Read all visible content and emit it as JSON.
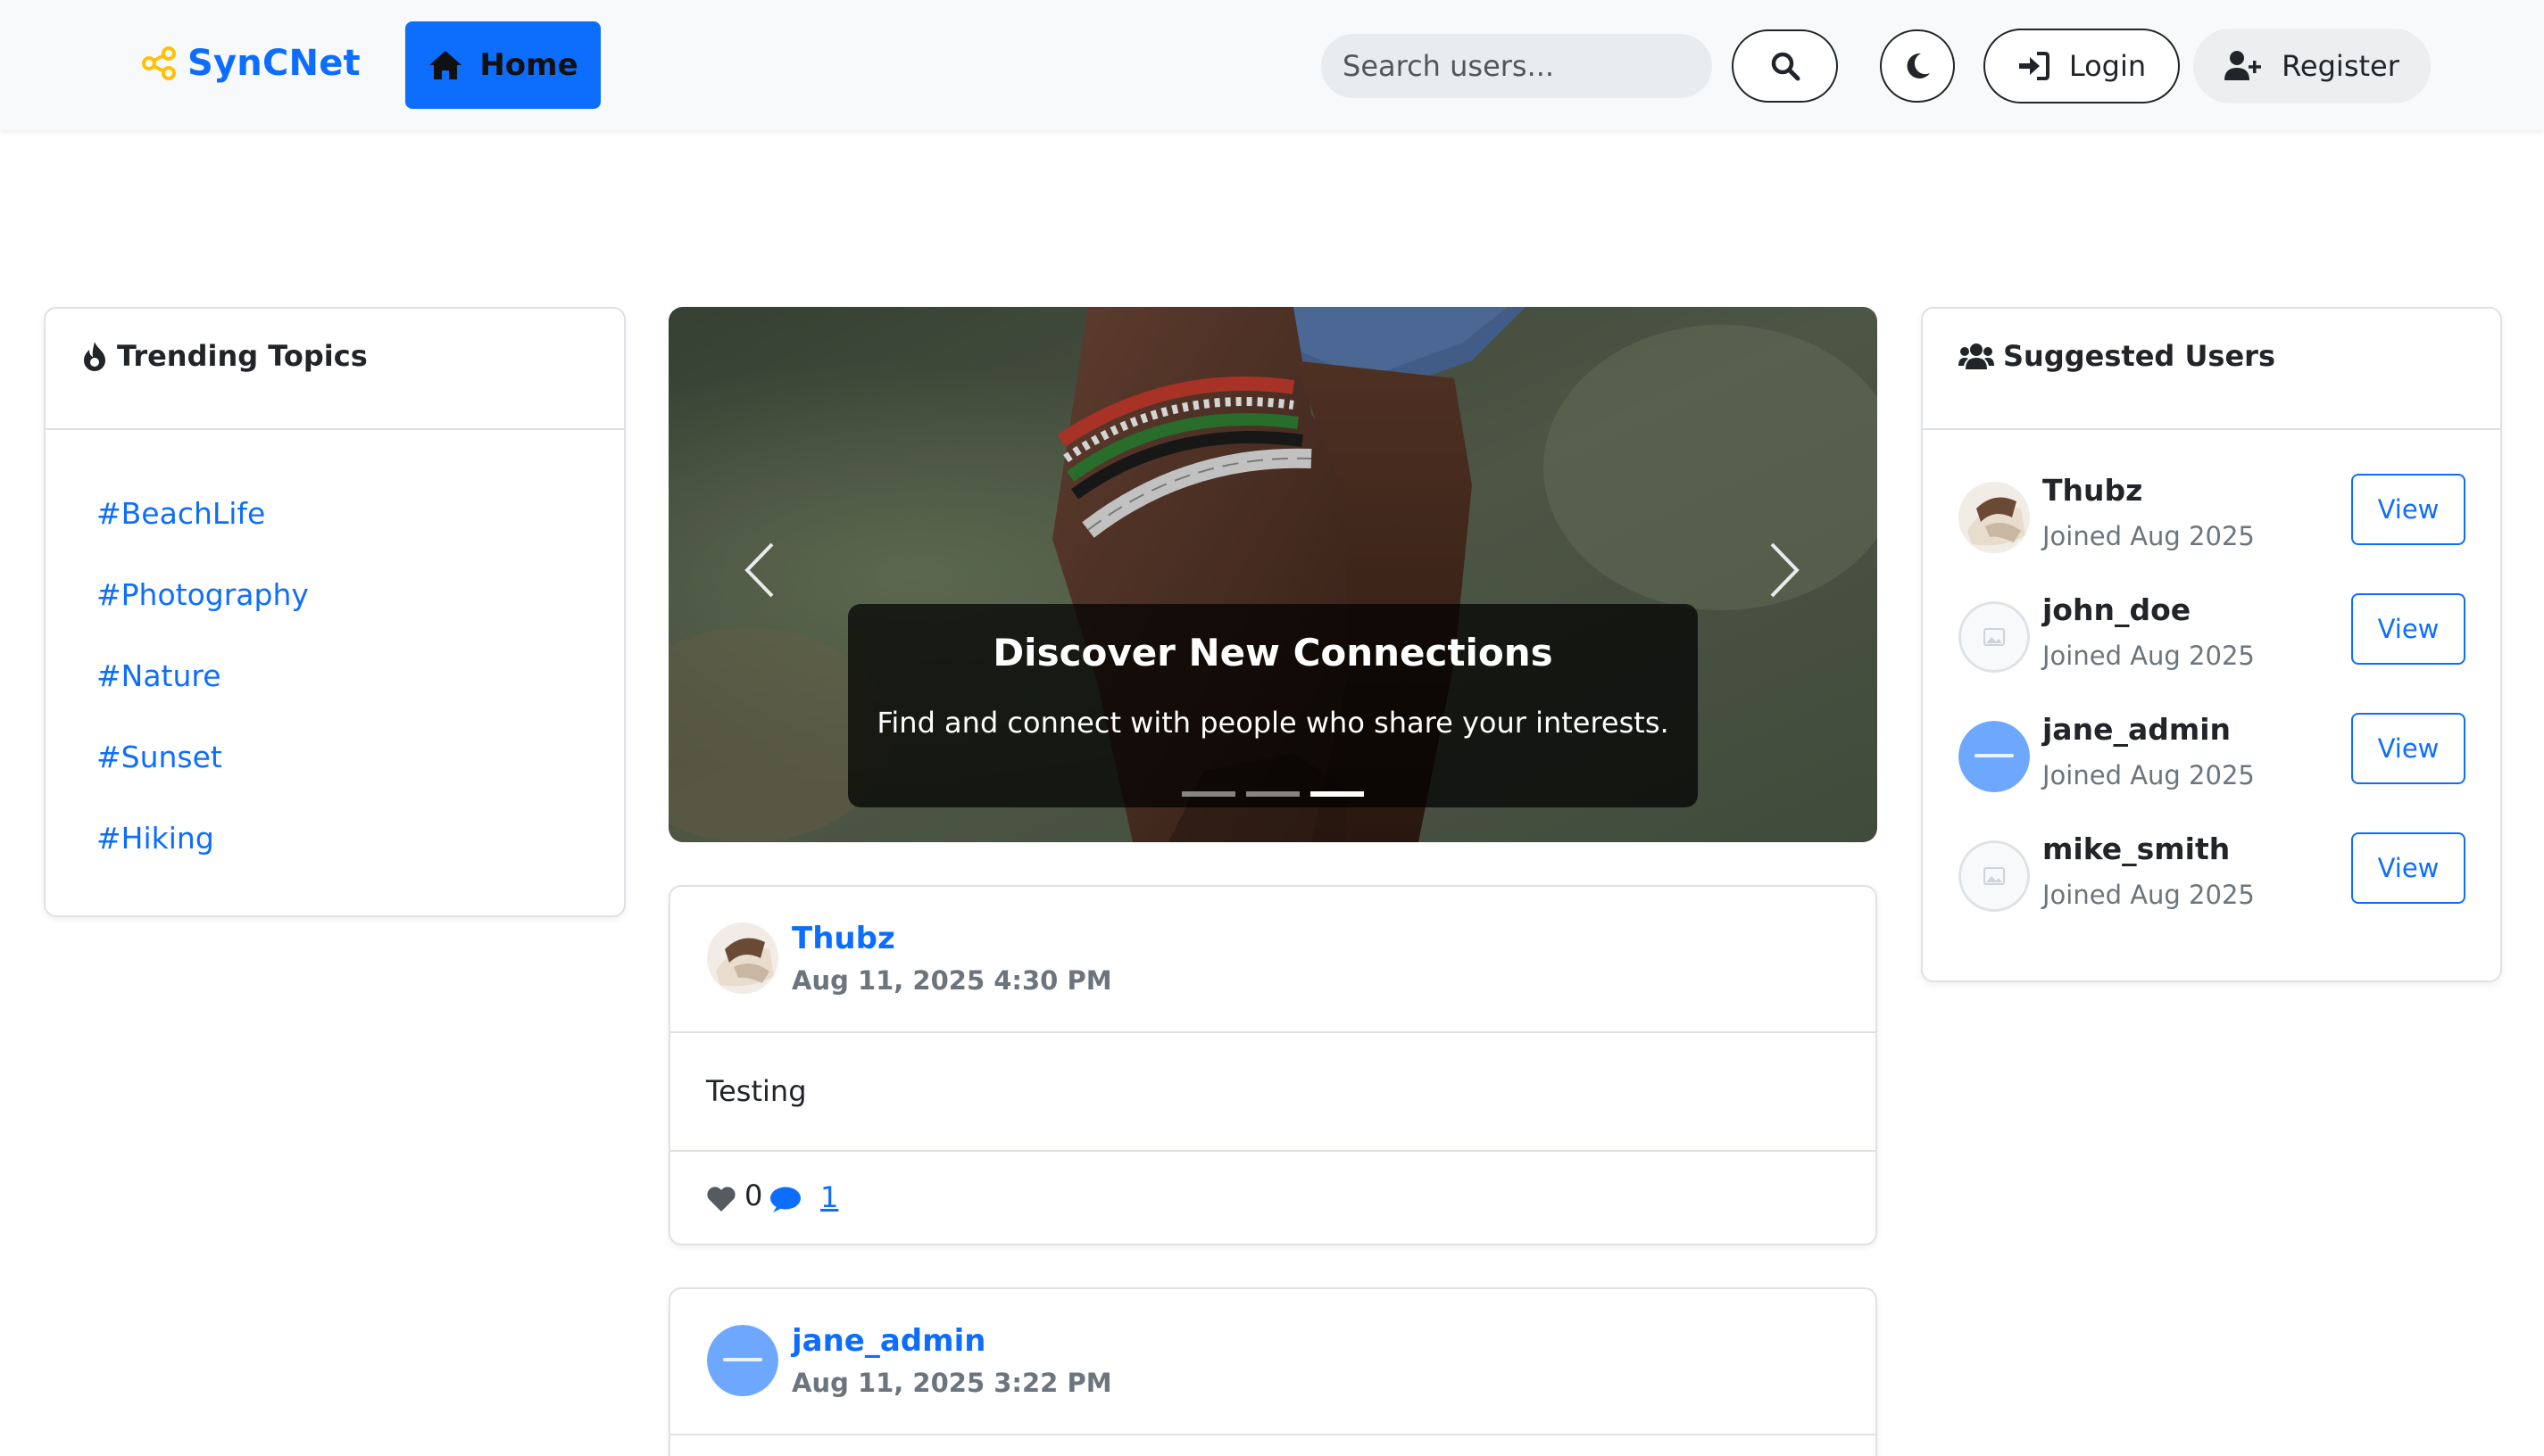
{
  "navbar": {
    "brand": "SynCNet",
    "home_label": "Home",
    "search_placeholder": "Search users...",
    "login_label": "Login",
    "register_label": "Register"
  },
  "trending": {
    "title": "Trending Topics",
    "topics": [
      "#BeachLife",
      "#Photography",
      "#Nature",
      "#Sunset",
      "#Hiking"
    ]
  },
  "carousel": {
    "caption_title": "Discover New Connections",
    "caption_text": "Find and connect with people who share your interests.",
    "slide_count": 3,
    "active_slide": 3
  },
  "posts": [
    {
      "author": "Thubz",
      "time": "Aug 11, 2025 4:30 PM",
      "content": "Testing",
      "likes": "0",
      "comments": "1"
    },
    {
      "author": "jane_admin",
      "time": "Aug 11, 2025 3:22 PM"
    }
  ],
  "suggested": {
    "title": "Suggested Users",
    "users": [
      {
        "name": "Thubz",
        "joined": "Joined Aug 2025",
        "view_label": "View"
      },
      {
        "name": "john_doe",
        "joined": "Joined Aug 2025",
        "view_label": "View"
      },
      {
        "name": "jane_admin",
        "joined": "Joined Aug 2025",
        "view_label": "View"
      },
      {
        "name": "mike_smith",
        "joined": "Joined Aug 2025",
        "view_label": "View"
      }
    ]
  },
  "colors": {
    "primary": "#0d6efd",
    "brand_icon": "#ffc107",
    "navbar_bg": "#f8f9fa",
    "muted": "#6c757d"
  },
  "icons": {
    "brand": "share-nodes-icon",
    "home": "home-icon",
    "search": "search-icon",
    "theme": "moon-icon",
    "login": "sign-in-icon",
    "register": "user-plus-icon",
    "trending": "fire-icon",
    "suggested": "users-icon",
    "like": "heart-icon",
    "comment": "comment-icon"
  }
}
